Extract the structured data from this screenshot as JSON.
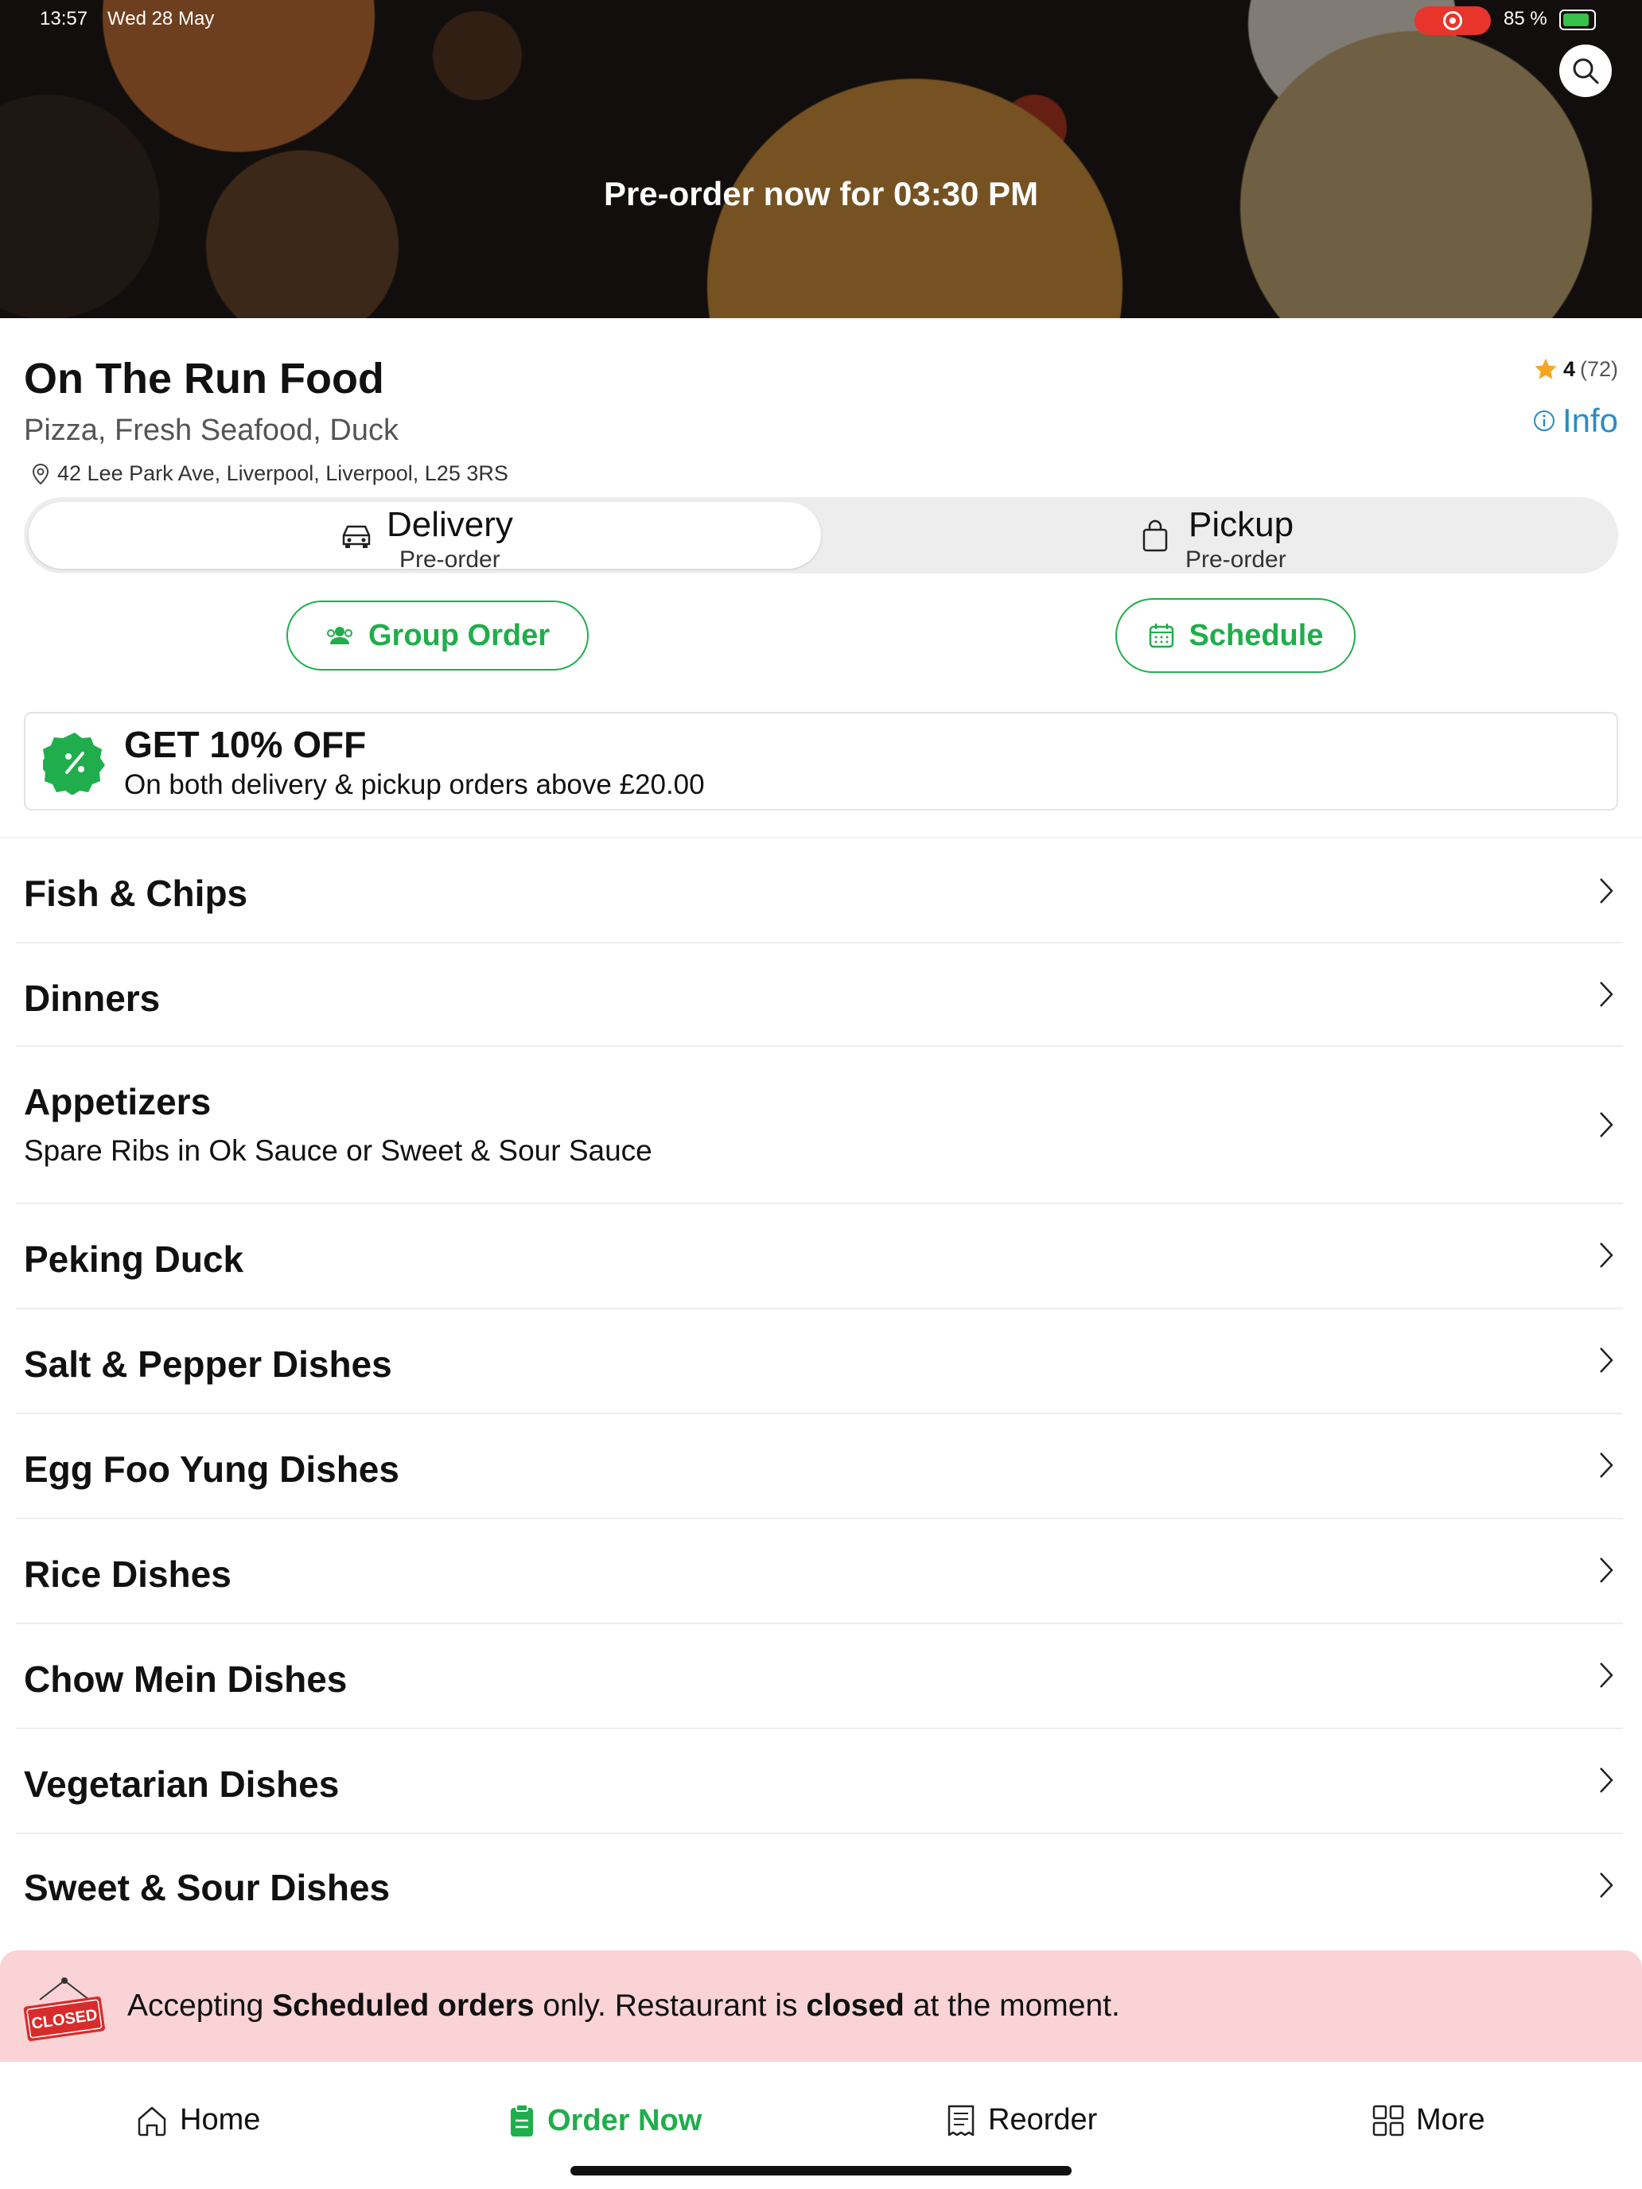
{
  "status_bar": {
    "time": "13:57",
    "date": "Wed 28 May",
    "battery": "85 %"
  },
  "hero": {
    "preorder_text": "Pre-order now for 03:30 PM"
  },
  "restaurant": {
    "name": "On The Run Food",
    "cuisine": "Pizza, Fresh Seafood, Duck",
    "address": "42 Lee Park Ave, Liverpool, Liverpool, L25 3RS",
    "rating": "4",
    "rating_count": "(72)",
    "info_label": "Info"
  },
  "order_mode": {
    "delivery": {
      "label": "Delivery",
      "sub": "Pre-order"
    },
    "pickup": {
      "label": "Pickup",
      "sub": "Pre-order"
    }
  },
  "actions": {
    "group_order": "Group Order",
    "schedule": "Schedule"
  },
  "promo": {
    "title": "GET 10% OFF",
    "subtitle": "On both delivery & pickup orders above £20.00"
  },
  "menu": [
    {
      "label": "Fish & Chips",
      "sub": ""
    },
    {
      "label": "Dinners",
      "sub": ""
    },
    {
      "label": "Appetizers",
      "sub": "Spare Ribs in Ok Sauce or Sweet & Sour Sauce"
    },
    {
      "label": "Peking Duck",
      "sub": ""
    },
    {
      "label": "Salt & Pepper Dishes",
      "sub": ""
    },
    {
      "label": "Egg Foo Yung Dishes",
      "sub": ""
    },
    {
      "label": "Rice Dishes",
      "sub": ""
    },
    {
      "label": "Chow Mein Dishes",
      "sub": ""
    },
    {
      "label": "Vegetarian Dishes",
      "sub": ""
    },
    {
      "label": "Sweet & Sour Dishes",
      "sub": ""
    }
  ],
  "closed_banner": {
    "sign": "CLOSED",
    "p1": "Accepting ",
    "b1": "Scheduled orders",
    "p2": " only. Restaurant is ",
    "b2": "closed",
    "p3": " at the moment."
  },
  "tabs": {
    "home": "Home",
    "order_now": "Order Now",
    "reorder": "Reorder",
    "more": "More"
  },
  "colors": {
    "accent": "#1fae4b",
    "info": "#2a8cc4",
    "closed_bg": "#f9d3d6",
    "star": "#f5a623"
  }
}
